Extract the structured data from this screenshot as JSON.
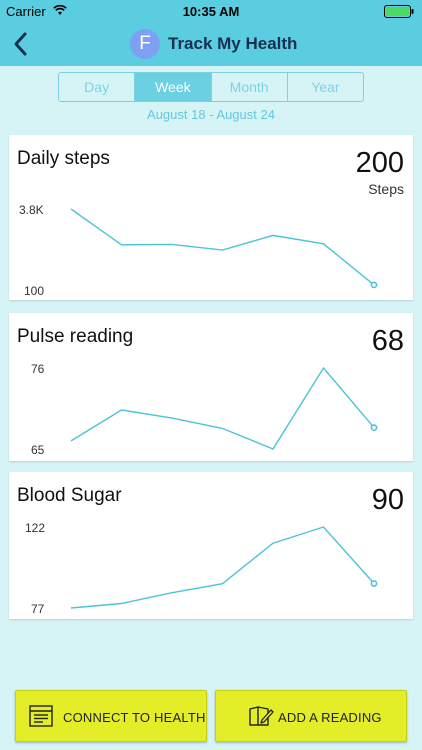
{
  "status_bar": {
    "carrier": "Carrier",
    "time": "10:35 AM"
  },
  "nav": {
    "avatar_letter": "F",
    "title": "Track My Health"
  },
  "tabs": [
    {
      "label": "Day",
      "active": false
    },
    {
      "label": "Week",
      "active": true
    },
    {
      "label": "Month",
      "active": false
    },
    {
      "label": "Year",
      "active": false
    }
  ],
  "date_range": "August 18 - August 24",
  "colors": {
    "header": "#5bcde0",
    "line": "#4cc3d8",
    "button": "#e4ee28",
    "background": "#d6f4f6"
  },
  "cards": {
    "steps": {
      "title": "Daily steps",
      "value": "200",
      "unit": "Steps",
      "y_max_label": "3.8K",
      "y_min_label": "100"
    },
    "pulse": {
      "title": "Pulse reading",
      "value": "68",
      "y_max_label": "76",
      "y_min_label": "65"
    },
    "sugar": {
      "title": "Blood Sugar",
      "value": "90",
      "y_max_label": "122",
      "y_min_label": "77"
    }
  },
  "chart_data": [
    {
      "type": "line",
      "title": "Daily steps",
      "ylim": [
        100,
        3800
      ],
      "series": [
        {
          "values": [
            3800,
            2100,
            2120,
            1850,
            2550,
            2150,
            200
          ]
        }
      ]
    },
    {
      "type": "line",
      "title": "Pulse reading",
      "ylim": [
        65,
        76
      ],
      "series": [
        {
          "values": [
            66.1,
            70.3,
            69.2,
            67.8,
            65,
            76,
            67.9
          ]
        }
      ]
    },
    {
      "type": "line",
      "title": "Blood Sugar",
      "ylim": [
        77,
        122
      ],
      "series": [
        {
          "values": [
            77,
            79.5,
            85.5,
            90.5,
            113,
            122,
            90.6
          ]
        }
      ]
    }
  ],
  "footer": {
    "connect_label": "CONNECT TO HEALTH",
    "add_label": "ADD A READING"
  }
}
